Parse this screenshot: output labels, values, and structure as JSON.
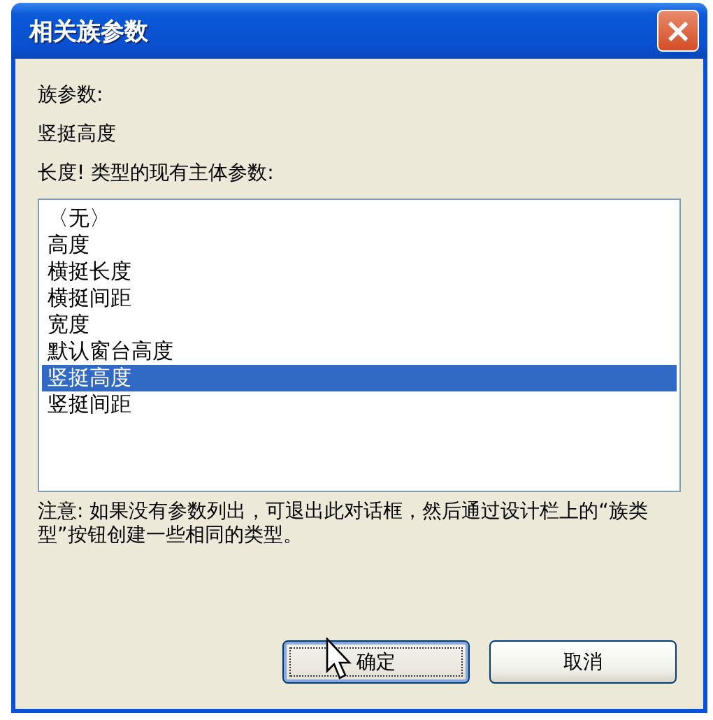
{
  "window": {
    "title": "相关族参数",
    "close_label": "×"
  },
  "family_parameter_label": "族参数:",
  "family_parameter_value": "竖挺高度",
  "list_label": "长度! 类型的现有主体参数:",
  "parameters": [
    {
      "label": "〈无〉",
      "selected": false
    },
    {
      "label": "高度",
      "selected": false
    },
    {
      "label": "横挺长度",
      "selected": false
    },
    {
      "label": "横挺间距",
      "selected": false
    },
    {
      "label": "宽度",
      "selected": false
    },
    {
      "label": "默认窗台高度",
      "selected": false
    },
    {
      "label": "竖挺高度",
      "selected": true
    },
    {
      "label": "竖挺间距",
      "selected": false
    }
  ],
  "note": "注意: 如果没有参数列出，可退出此对话框，然后通过设计栏上的“族类型”按钮创建一些相同的类型。",
  "buttons": [
    {
      "label": "确定",
      "default": true
    },
    {
      "label": "取消",
      "default": false
    }
  ]
}
